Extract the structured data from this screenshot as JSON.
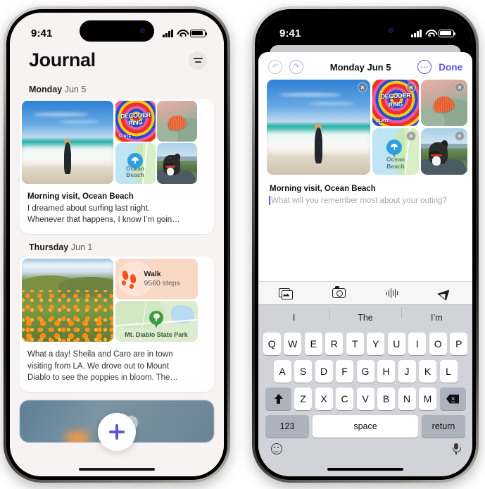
{
  "left_phone": {
    "status_bar": {
      "time": "9:41",
      "signal_icon": "cellular-signal-icon",
      "wifi_icon": "wifi-icon",
      "battery_icon": "battery-icon"
    },
    "header": {
      "title": "Journal",
      "filter_icon": "filter-icon"
    },
    "sections": [
      {
        "day": "Monday",
        "date": "Jun 5",
        "entry": {
          "title": "Morning visit, Ocean Beach",
          "body_line1": "I dreamed about surfing last night.",
          "body_line2": "Whenever that happens, I know I’m goin…",
          "media": [
            {
              "name": "surfer-beach-photo"
            },
            {
              "name": "decoder-ring-podcast-art",
              "line1": "DECODER",
              "line2": "RING",
              "line3": "SLATE"
            },
            {
              "name": "seashell-photo"
            },
            {
              "name": "ocean-beach-map",
              "label_line1": "Ocean",
              "label_line2": "Beach"
            },
            {
              "name": "dog-in-car-photo"
            }
          ]
        }
      },
      {
        "day": "Thursday",
        "date": "Jun 1",
        "entry": {
          "body_line1": "What a day! Sheila and Caro are in town",
          "body_line2": "visiting from LA. We drove out to Mount",
          "body_line3": "Diablo to see the poppies in bloom. The…",
          "media": [
            {
              "name": "poppy-field-photo"
            }
          ],
          "walk_card": {
            "title": "Walk",
            "value": "9560 steps",
            "icon": "footsteps-icon"
          },
          "map_card": {
            "label": "Mt. Diablo State Park",
            "icon": "tree-pin-icon"
          }
        }
      }
    ],
    "add_button": {
      "icon": "plus-icon"
    },
    "home_indicator": "home-indicator"
  },
  "right_phone": {
    "status_bar": {
      "time": "9:41",
      "signal_icon": "cellular-signal-icon",
      "wifi_icon": "wifi-icon",
      "battery_icon": "battery-icon"
    },
    "editor": {
      "undo_icon": "undo-icon",
      "redo_icon": "redo-icon",
      "title": "Monday Jun 5",
      "more_icon": "ellipsis-icon",
      "done_label": "Done",
      "media": [
        {
          "name": "surfer-beach-photo",
          "remove_label": "×"
        },
        {
          "name": "decoder-ring-podcast-art",
          "line1": "DECODER",
          "line2": "RING",
          "line3": "SLATE",
          "remove_label": "×"
        },
        {
          "name": "seashell-photo",
          "remove_label": "×"
        },
        {
          "name": "ocean-beach-map",
          "label_line1": "Ocean",
          "label_line2": "Beach",
          "remove_label": "×"
        },
        {
          "name": "dog-in-car-photo",
          "remove_label": "×"
        }
      ],
      "entry_title": "Morning visit, Ocean Beach",
      "placeholder": "What will you remember most about your outing?",
      "toolbar": [
        {
          "name": "photos-icon"
        },
        {
          "name": "camera-icon"
        },
        {
          "name": "audio-waveform-icon"
        },
        {
          "name": "location-icon"
        }
      ]
    },
    "keyboard": {
      "predictions": [
        "I",
        "The",
        "I’m"
      ],
      "row1": [
        "Q",
        "W",
        "E",
        "R",
        "T",
        "Y",
        "U",
        "I",
        "O",
        "P"
      ],
      "row2": [
        "A",
        "S",
        "D",
        "F",
        "G",
        "H",
        "J",
        "K",
        "L"
      ],
      "row3": [
        "Z",
        "X",
        "C",
        "V",
        "B",
        "N",
        "M"
      ],
      "shift_icon": "shift-icon",
      "delete_icon": "backspace-icon",
      "numbers_label": "123",
      "space_label": "space",
      "return_label": "return",
      "emoji_icon": "emoji-icon",
      "mic_icon": "microphone-icon"
    },
    "home_indicator": "home-indicator"
  },
  "colors": {
    "accent": "#5b56e0",
    "journal_bg": "#f8f3f3",
    "walk_card": "#fad8c6",
    "map_card": "#dcecd0",
    "keyboard_bg": "#d1d3d9"
  }
}
